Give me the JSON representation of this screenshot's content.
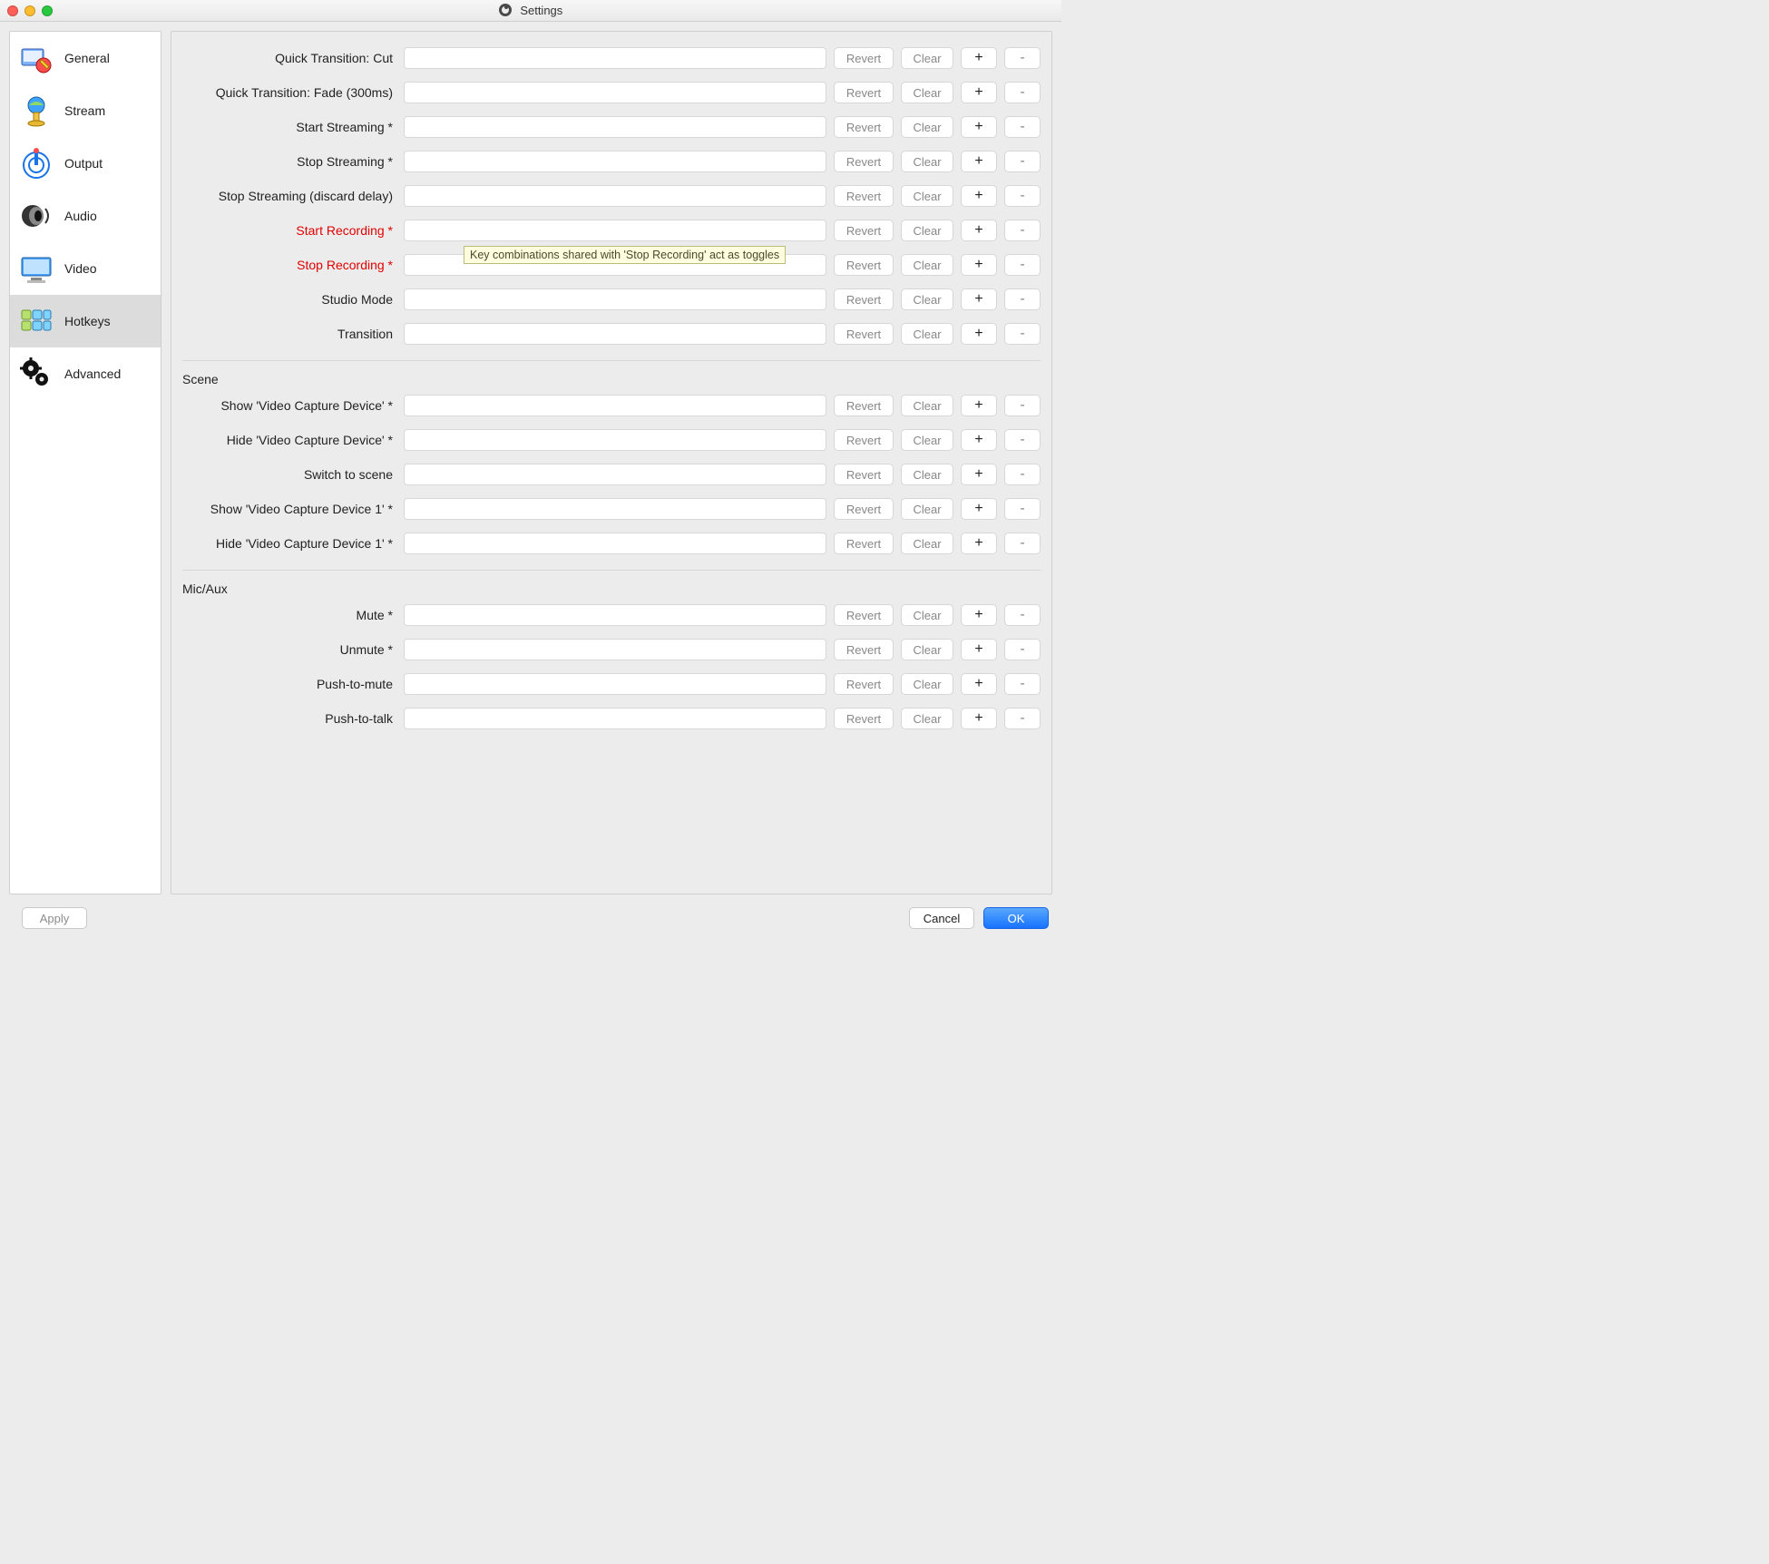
{
  "window": {
    "title": "Settings"
  },
  "sidebar": {
    "items": [
      {
        "label": "General"
      },
      {
        "label": "Stream"
      },
      {
        "label": "Output"
      },
      {
        "label": "Audio"
      },
      {
        "label": "Video"
      },
      {
        "label": "Hotkeys"
      },
      {
        "label": "Advanced"
      }
    ],
    "selected_index": 5
  },
  "buttons": {
    "revert": "Revert",
    "clear": "Clear",
    "plus": "+",
    "minus": "-"
  },
  "tooltip": {
    "text": "Key combinations shared with 'Stop Recording' act as toggles"
  },
  "sections": [
    {
      "header": "",
      "rows": [
        {
          "label": "Quick Transition: Cut",
          "highlight": false
        },
        {
          "label": "Quick Transition: Fade (300ms)",
          "highlight": false
        },
        {
          "label": "Start Streaming *",
          "highlight": false
        },
        {
          "label": "Stop Streaming *",
          "highlight": false
        },
        {
          "label": "Stop Streaming (discard delay)",
          "highlight": false
        },
        {
          "label": "Start Recording *",
          "highlight": true
        },
        {
          "label": "Stop Recording *",
          "highlight": true
        },
        {
          "label": "Studio Mode",
          "highlight": false
        },
        {
          "label": "Transition",
          "highlight": false
        }
      ]
    },
    {
      "header": "Scene",
      "rows": [
        {
          "label": "Show 'Video Capture Device' *",
          "highlight": false
        },
        {
          "label": "Hide 'Video Capture Device' *",
          "highlight": false
        },
        {
          "label": "Switch to scene",
          "highlight": false
        },
        {
          "label": "Show 'Video Capture Device 1' *",
          "highlight": false
        },
        {
          "label": "Hide 'Video Capture Device 1' *",
          "highlight": false
        }
      ]
    },
    {
      "header": "Mic/Aux",
      "rows": [
        {
          "label": "Mute *",
          "highlight": false
        },
        {
          "label": "Unmute *",
          "highlight": false
        },
        {
          "label": "Push-to-mute",
          "highlight": false
        },
        {
          "label": "Push-to-talk",
          "highlight": false
        }
      ]
    }
  ],
  "footer": {
    "apply": "Apply",
    "cancel": "Cancel",
    "ok": "OK"
  }
}
